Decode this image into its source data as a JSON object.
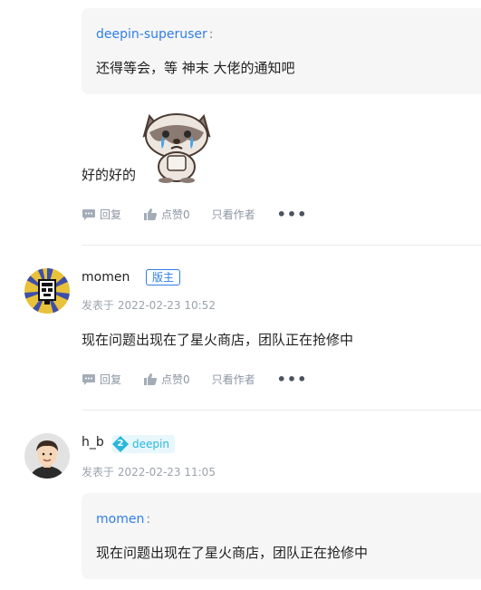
{
  "thread": {
    "quote1": {
      "author": "deepin-superuser",
      "colon": ":",
      "text": "还得等会，等 神末 大佬的通知吧"
    },
    "reply1": {
      "text": "好的好的"
    },
    "actions": {
      "reply": "回复",
      "like": "点赞0",
      "author_only": "只看作者",
      "more": "•••"
    },
    "post2": {
      "username": "momen",
      "badge": "版主",
      "meta": "发表于 2022-02-23 10:52",
      "text": "现在问题出现在了星火商店，团队正在抢修中"
    },
    "post3": {
      "username": "h_b",
      "level": "2",
      "level_name": "deepin",
      "meta": "发表于 2022-02-23 11:05",
      "quote": {
        "author": "momen",
        "colon": ":",
        "text": "现在问题出现在了星火商店，团队正在抢修中"
      }
    }
  }
}
